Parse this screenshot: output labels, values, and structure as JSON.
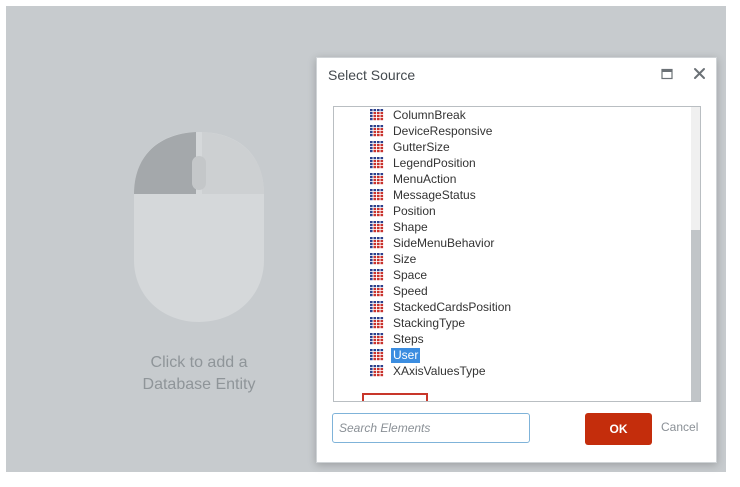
{
  "placeholder": {
    "line1": "Click to add a",
    "line2": "Database Entity"
  },
  "dialog": {
    "title": "Select Source",
    "maximize_icon": "maximize-icon",
    "close_icon": "close-icon"
  },
  "tree": {
    "item_icon": "table-icon",
    "items": [
      "ColumnBreak",
      "DeviceResponsive",
      "GutterSize",
      "LegendPosition",
      "MenuAction",
      "MessageStatus",
      "Position",
      "Shape",
      "SideMenuBehavior",
      "Size",
      "Space",
      "Speed",
      "StackedCardsPosition",
      "StackingType",
      "Steps",
      "User",
      "XAxisValuesType"
    ],
    "selected": "User"
  },
  "search": {
    "placeholder": "Search Elements",
    "value": ""
  },
  "buttons": {
    "ok": "OK",
    "cancel": "Cancel"
  },
  "colors": {
    "background": "#c7cbce",
    "accent": "#c42d0c",
    "selection": "#3b8de0",
    "highlight_box": "#c8362a"
  }
}
